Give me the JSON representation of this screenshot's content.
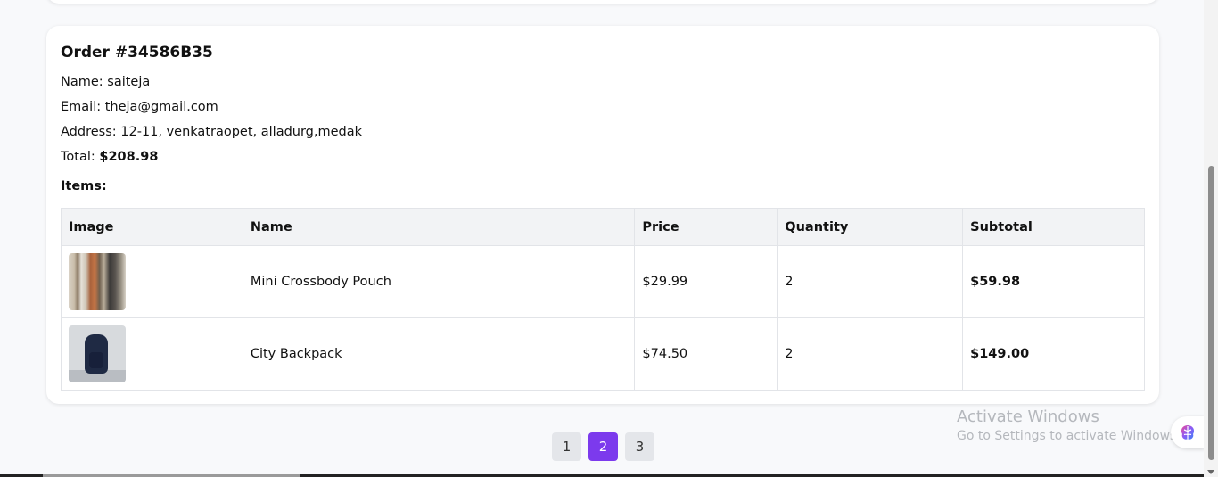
{
  "order": {
    "title": "Order #34586B35",
    "name_label": "Name:",
    "name": "saiteja",
    "email_label": "Email:",
    "email": "theja@gmail.com",
    "address_label": "Address:",
    "address": "12-11, venkatraopet, alladurg,medak",
    "total_label": "Total:",
    "total": "$208.98",
    "items_label": "Items:"
  },
  "table": {
    "headers": [
      "Image",
      "Name",
      "Price",
      "Quantity",
      "Subtotal"
    ],
    "rows": [
      {
        "image_icon": "clothes-rack-image",
        "name": "Mini Crossbody Pouch",
        "price": "$29.99",
        "quantity": "2",
        "subtotal": "$59.98"
      },
      {
        "image_icon": "backpack-image",
        "name": "City Backpack",
        "price": "$74.50",
        "quantity": "2",
        "subtotal": "$149.00"
      }
    ]
  },
  "pagination": {
    "pages": [
      "1",
      "2",
      "3"
    ],
    "active": "2"
  },
  "watermark": {
    "title": "Activate Windows",
    "subtitle": "Go to Settings to activate Windows."
  },
  "colors": {
    "accent": "#7c3aed",
    "background": "#f8f9fb",
    "card": "#ffffff"
  }
}
